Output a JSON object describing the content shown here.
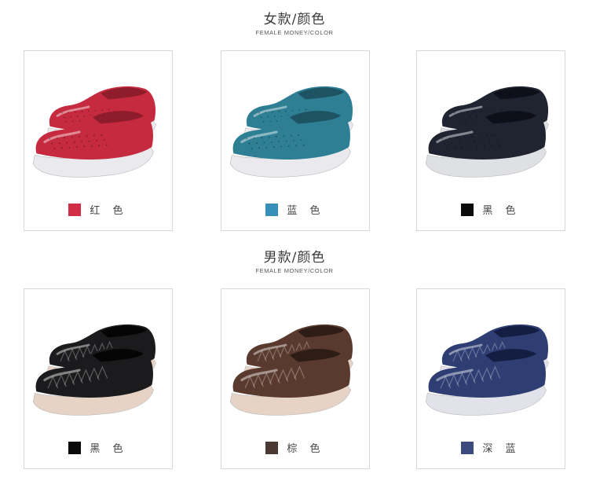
{
  "female": {
    "title": "女款/颜色",
    "subtitle": "FEMALE MONEY/COLOR",
    "items": [
      {
        "label": "红 色",
        "swatch": "#d02d46",
        "color": "#c52a3e",
        "shade": "#8e1c2b",
        "sole": "#e9e9ee"
      },
      {
        "label": "蓝 色",
        "swatch": "#3690ba",
        "color": "#2f7f94",
        "shade": "#1d5362",
        "sole": "#e9e9ee"
      },
      {
        "label": "黑 色",
        "swatch": "#0a0a0a",
        "color": "#1f2430",
        "shade": "#0d1018",
        "sole": "#dfe0e4"
      }
    ]
  },
  "male": {
    "title": "男款/颜色",
    "subtitle": "FEMALE MONEY/COLOR",
    "items": [
      {
        "label": "黑 色",
        "swatch": "#0a0a0a",
        "color": "#1b1b1d",
        "shade": "#050505",
        "sole": "#e7d3c6"
      },
      {
        "label": "棕 色",
        "swatch": "#4a3a33",
        "color": "#5a3a2e",
        "shade": "#2e1c16",
        "sole": "#e7d3c6"
      },
      {
        "label": "深 蓝",
        "swatch": "#3d4a7d",
        "color": "#2e3d72",
        "shade": "#141d42",
        "sole": "#e2e3ea"
      }
    ]
  }
}
